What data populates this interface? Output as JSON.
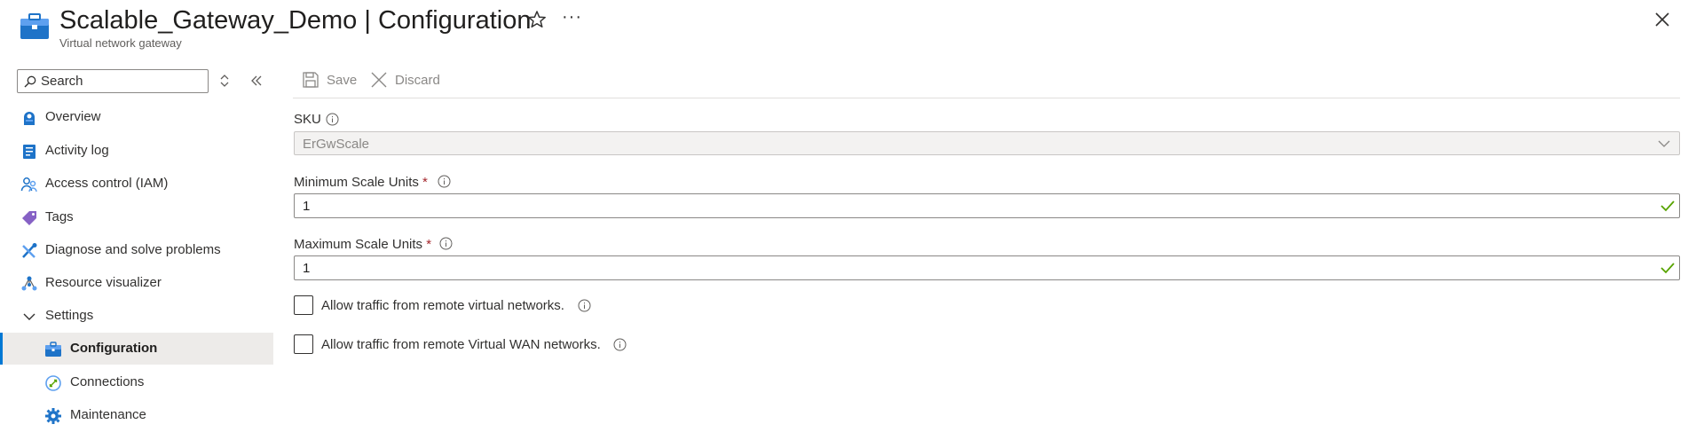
{
  "header": {
    "resource_name": "Scalable_Gateway_Demo",
    "separator": " | ",
    "blade_title": "Configuration",
    "resource_type": "Virtual network gateway"
  },
  "sidebar": {
    "search": {
      "placeholder": "Search",
      "value": ""
    },
    "items": [
      {
        "label": "Overview",
        "icon": "overview-icon"
      },
      {
        "label": "Activity log",
        "icon": "activity-log-icon"
      },
      {
        "label": "Access control (IAM)",
        "icon": "iam-icon"
      },
      {
        "label": "Tags",
        "icon": "tag-icon"
      },
      {
        "label": "Diagnose and solve problems",
        "icon": "diagnose-icon"
      },
      {
        "label": "Resource visualizer",
        "icon": "resource-visualizer-icon"
      },
      {
        "label": "Settings",
        "icon": "chevron-down-icon"
      },
      {
        "label": "Configuration",
        "icon": "configuration-icon",
        "active": true
      },
      {
        "label": "Connections",
        "icon": "connections-icon"
      },
      {
        "label": "Maintenance",
        "icon": "maintenance-icon"
      }
    ]
  },
  "toolbar": {
    "save_label": "Save",
    "discard_label": "Discard"
  },
  "form": {
    "sku": {
      "label": "SKU",
      "value": "ErGwScale"
    },
    "min_scale": {
      "label": "Minimum Scale Units",
      "required_mark": "*",
      "value": "1"
    },
    "max_scale": {
      "label": "Maximum Scale Units",
      "required_mark": "*",
      "value": "1"
    },
    "allow_remote_vnet": {
      "label": "Allow traffic from remote virtual networks.",
      "checked": false
    },
    "allow_remote_vwan": {
      "label": "Allow traffic from remote Virtual WAN networks.",
      "checked": false
    }
  },
  "colors": {
    "accent": "#0078d4",
    "required": "#a4262c",
    "valid": "#57a300",
    "active_bg": "#edebe9"
  }
}
